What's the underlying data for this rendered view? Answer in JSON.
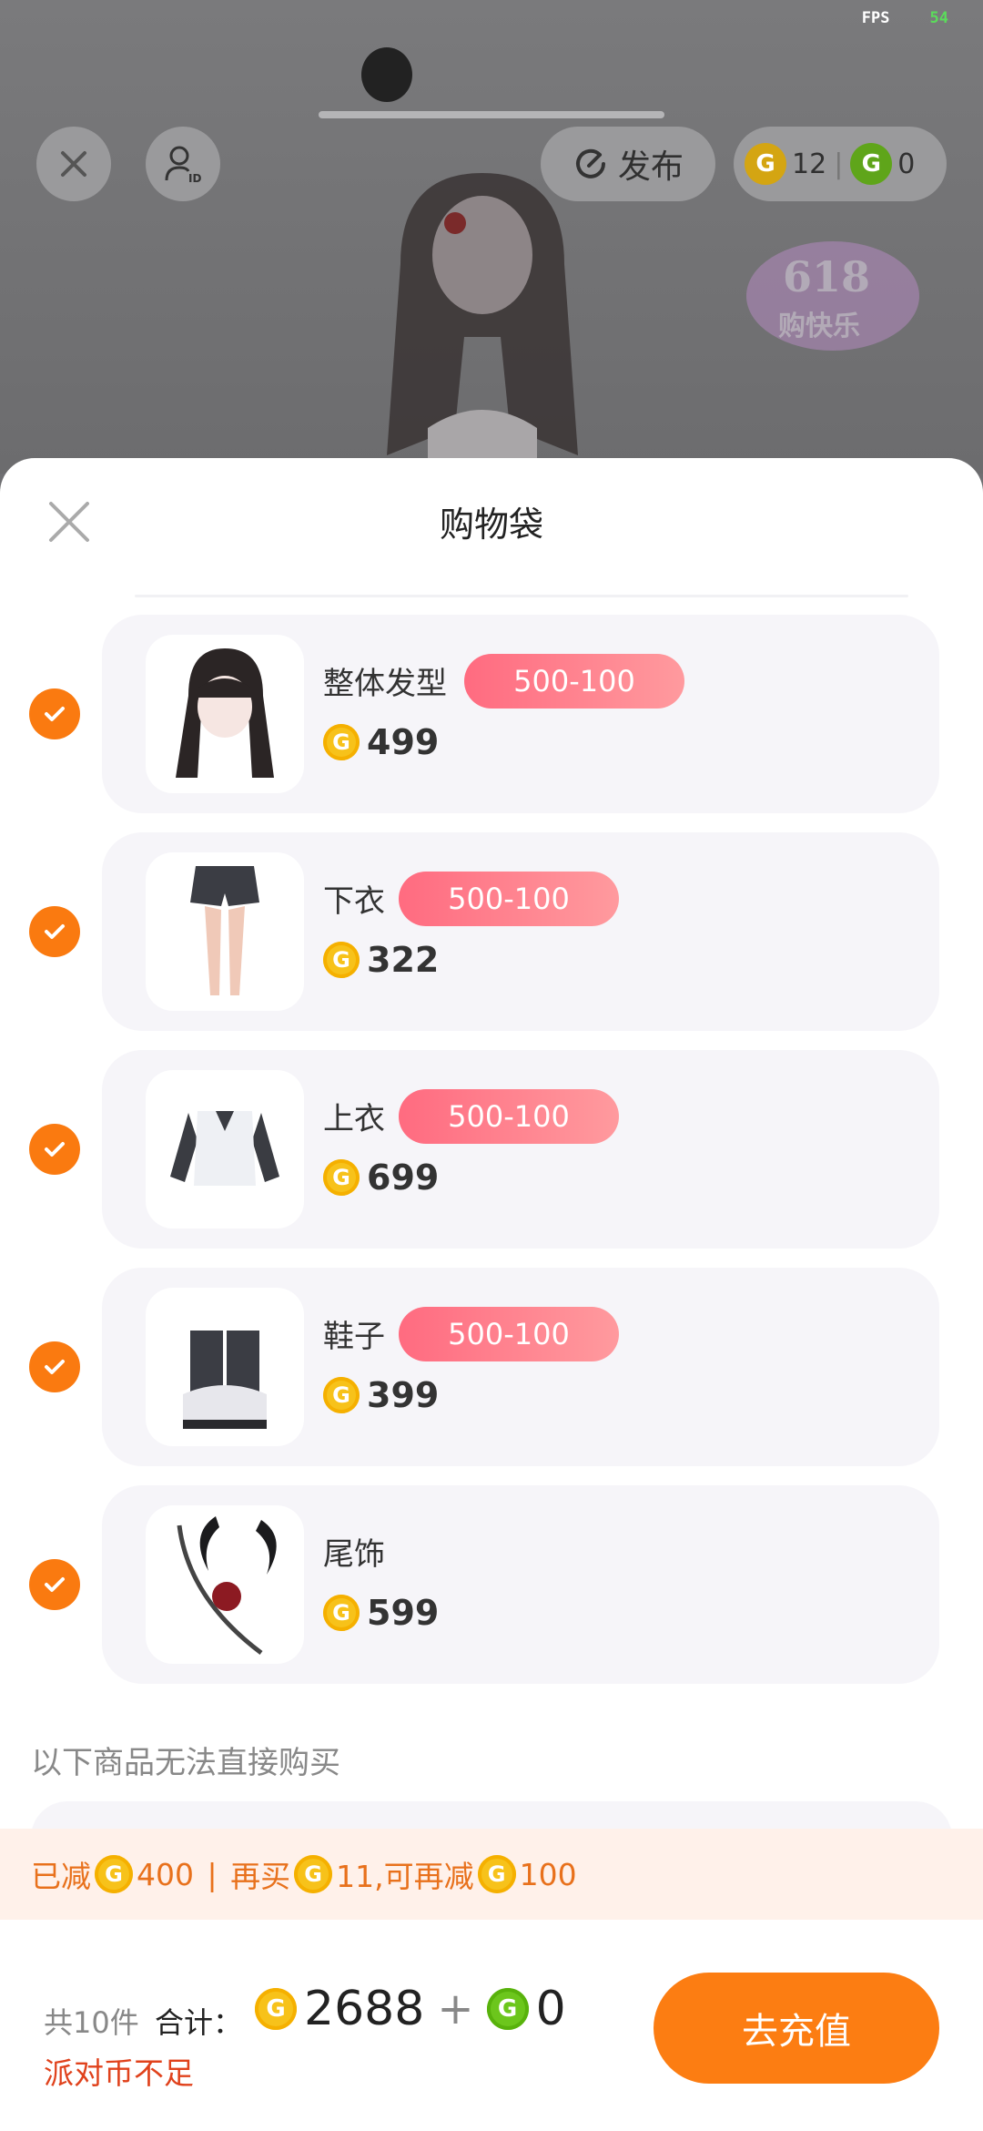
{
  "status": {
    "fps_label": "FPS",
    "fps_value": "54"
  },
  "topbar": {
    "publish_label": "发布",
    "gold_coins": "12",
    "green_coins": "0"
  },
  "sheet": {
    "title": "购物袋",
    "items": [
      {
        "name": "整体发型",
        "promo": "500-100",
        "price": "499",
        "checked": true
      },
      {
        "name": "下衣",
        "promo": "500-100",
        "price": "322",
        "checked": true
      },
      {
        "name": "上衣",
        "promo": "500-100",
        "price": "699",
        "checked": true
      },
      {
        "name": "鞋子",
        "promo": "500-100",
        "price": "399",
        "checked": true
      },
      {
        "name": "尾饰",
        "promo": "",
        "price": "599",
        "checked": true
      }
    ],
    "unavailable_label": "以下商品无法直接购买"
  },
  "discount": {
    "reduced_prefix": "已减",
    "reduced_amount": "400",
    "sep": " | ",
    "buy_more_prefix": "再买",
    "buy_more_amount": "11,可再减",
    "extra_amount": "100"
  },
  "footer": {
    "count_label": "共10件",
    "total_label": "合计：",
    "gold_total": "2688",
    "plus": "+",
    "green_total": "0",
    "warning": "派对币不足",
    "recharge_label": "去充值"
  },
  "colors": {
    "accent": "#fc7d12",
    "promo_pink": "#ff6b80",
    "coin_gold": "#f7c21a",
    "coin_green": "#6cc61c"
  }
}
